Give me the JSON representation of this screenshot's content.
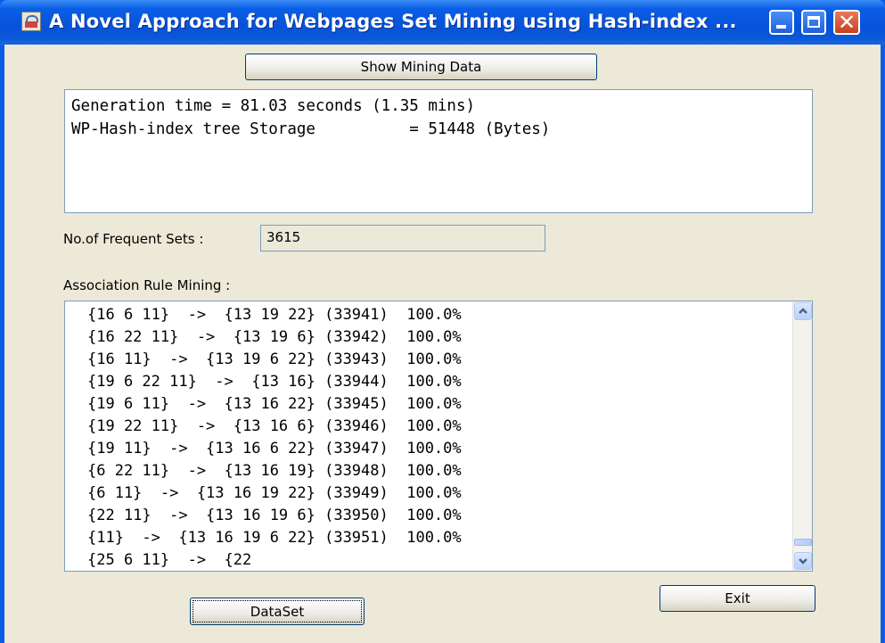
{
  "window": {
    "title": "A Novel Approach for Webpages Set Mining  using Hash-index ...",
    "close_glyph": "✕"
  },
  "show_mining_button": {
    "label": "Show Mining Data"
  },
  "output": {
    "lines": [
      "Generation time = 81.03 seconds (1.35 mins)",
      "WP-Hash-index tree Storage          = 51448 (Bytes)"
    ]
  },
  "frequent_sets": {
    "label": "No.of Frequent Sets :",
    "value": "3615"
  },
  "association": {
    "label": "Association Rule Mining :",
    "rules": [
      "{16 6 11}  ->  {13 19 22} (33941)  100.0%",
      "{16 22 11}  ->  {13 19 6} (33942)  100.0%",
      "{16 11}  ->  {13 19 6 22} (33943)  100.0%",
      "{19 6 22 11}  ->  {13 16} (33944)  100.0%",
      "{19 6 11}  ->  {13 16 22} (33945)  100.0%",
      "{19 22 11}  ->  {13 16 6} (33946)  100.0%",
      "{19 11}  ->  {13 16 6 22} (33947)  100.0%",
      "{6 22 11}  ->  {13 16 19} (33948)  100.0%",
      "{6 11}  ->  {13 16 19 22} (33949)  100.0%",
      "{22 11}  ->  {13 16 19 6} (33950)  100.0%",
      "{11}  ->  {13 16 19 6 22} (33951)  100.0%",
      "{25 6 11}  ->  {22"
    ],
    "scroll_position": 0.97
  },
  "buttons": {
    "dataset": "DataSet",
    "exit": "Exit"
  }
}
